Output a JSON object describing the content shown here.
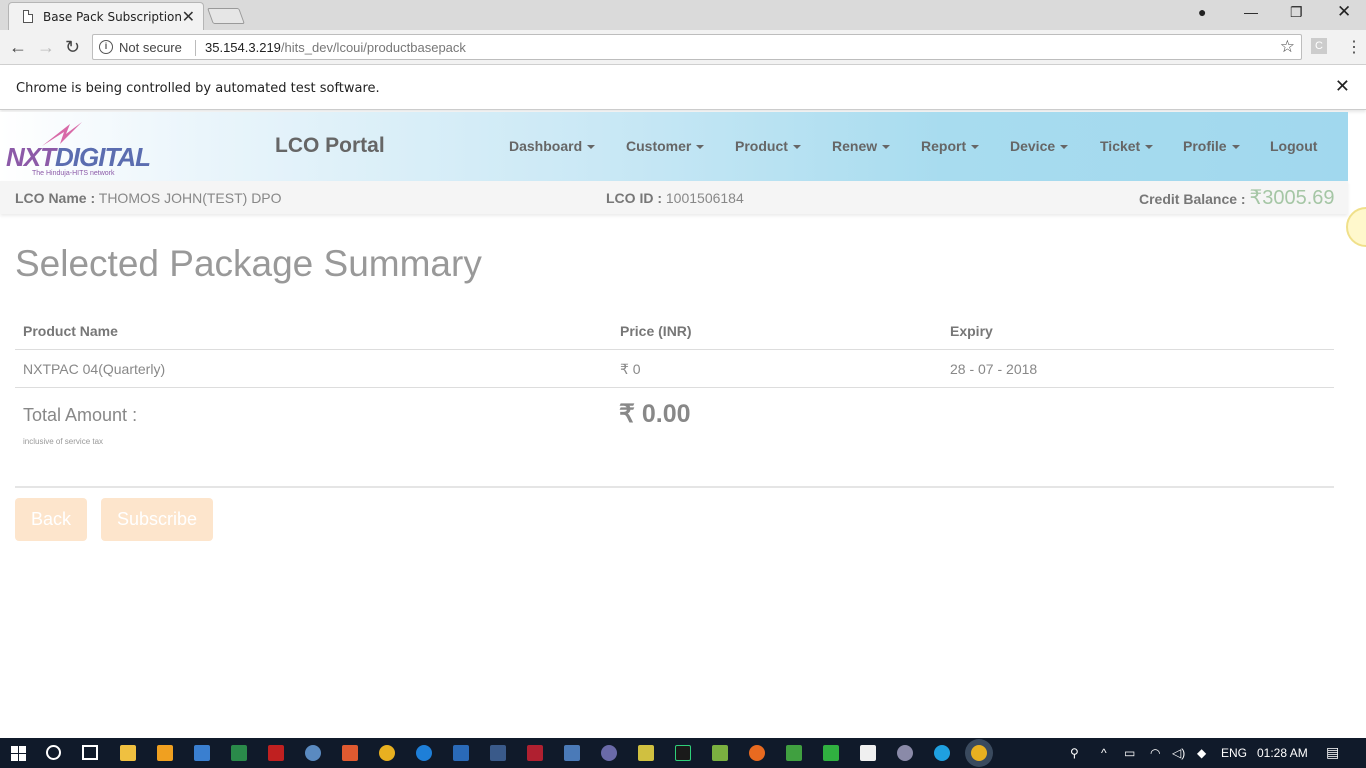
{
  "browser": {
    "tab_title": "Base Pack Subscription",
    "not_secure": "Not secure",
    "url_host": "35.154.3.219",
    "url_path": "/hits_dev/lcoui/productbasepack",
    "ext_letter": "C",
    "infobar_message": "Chrome is being controlled by automated test software."
  },
  "header": {
    "logo_text_1": "NXT",
    "logo_text_2": "DIGITAL",
    "logo_tagline": "The Hinduja-HITS network",
    "portal_title": "LCO Portal",
    "nav": [
      "Dashboard",
      "Customer",
      "Product",
      "Renew",
      "Report",
      "Device",
      "Ticket",
      "Profile",
      "Logout"
    ]
  },
  "info": {
    "lco_name_label": "LCO Name :",
    "lco_name_value": "THOMOS JOHN(TEST) DPO",
    "lco_id_label": "LCO ID :",
    "lco_id_value": "1001506184",
    "credit_label": "Credit Balance :",
    "credit_value": "₹3005.69"
  },
  "main": {
    "title": "Selected Package Summary",
    "columns": [
      "Product Name",
      "Price (INR)",
      "Expiry"
    ],
    "row": {
      "product": "NXTPAC 04(Quarterly)",
      "price": "₹ 0",
      "expiry": "28 - 07 - 2018"
    },
    "total_label": "Total Amount :",
    "total_note": "inclusive of service tax",
    "total_value": "₹ 0.00",
    "back_label": "Back",
    "subscribe_label": "Subscribe"
  },
  "taskbar": {
    "lang": "ENG",
    "time": "01:28 AM"
  },
  "colors": {
    "header_gradient_end": "#a1d8ee",
    "button_disabled": "#fde5cc",
    "credit_value": "#a5c6a5"
  }
}
